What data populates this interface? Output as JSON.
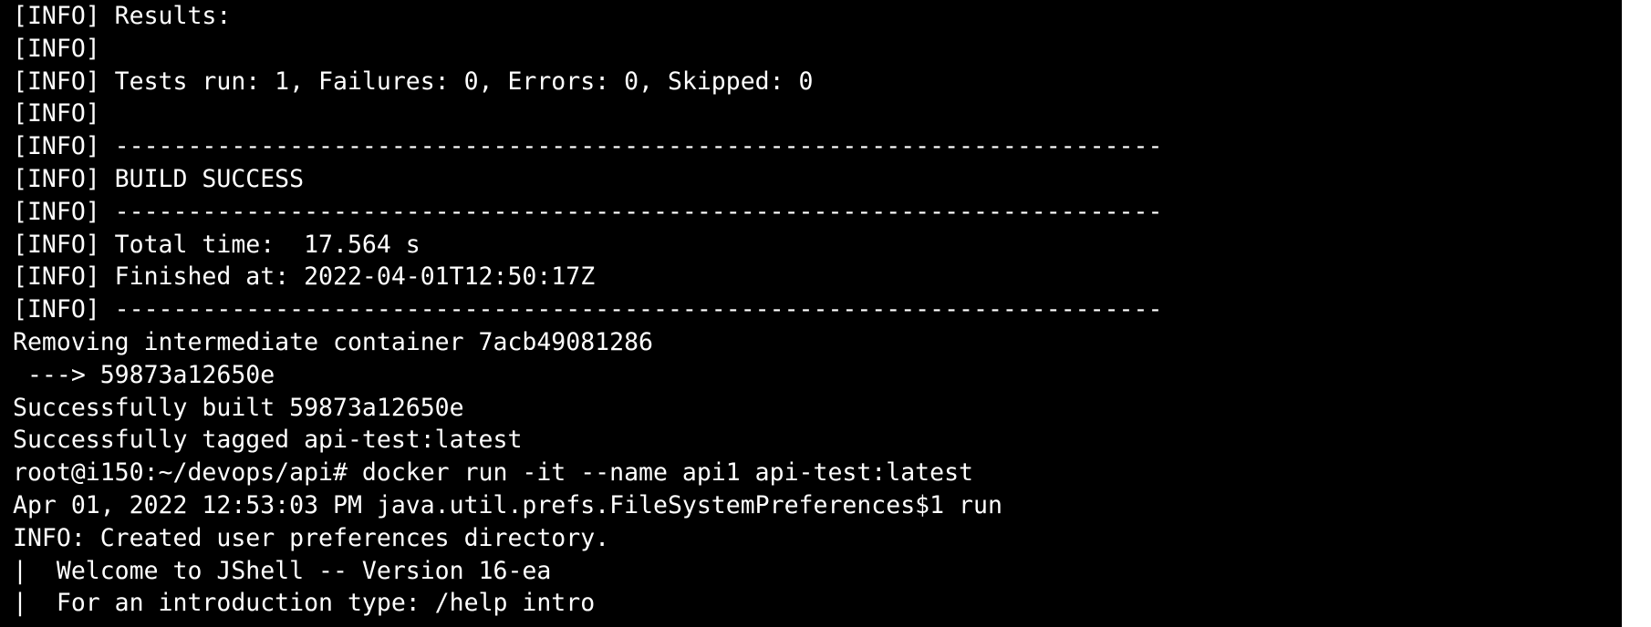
{
  "terminal": {
    "background": "#000000",
    "foreground": "#ffffff",
    "lines": [
      "[INFO] Results:",
      "[INFO]",
      "[INFO] Tests run: 1, Failures: 0, Errors: 0, Skipped: 0",
      "[INFO]",
      "[INFO] ------------------------------------------------------------------------",
      "[INFO] BUILD SUCCESS",
      "[INFO] ------------------------------------------------------------------------",
      "[INFO] Total time:  17.564 s",
      "[INFO] Finished at: 2022-04-01T12:50:17Z",
      "[INFO] ------------------------------------------------------------------------",
      "Removing intermediate container 7acb49081286",
      " ---> 59873a12650e",
      "Successfully built 59873a12650e",
      "Successfully tagged api-test:latest",
      "root@i150:~/devops/api# docker run -it --name api1 api-test:latest",
      "Apr 01, 2022 12:53:03 PM java.util.prefs.FileSystemPreferences$1 run",
      "INFO: Created user preferences directory.",
      "|  Welcome to JShell -- Version 16-ea",
      "|  For an introduction type: /help intro"
    ]
  }
}
